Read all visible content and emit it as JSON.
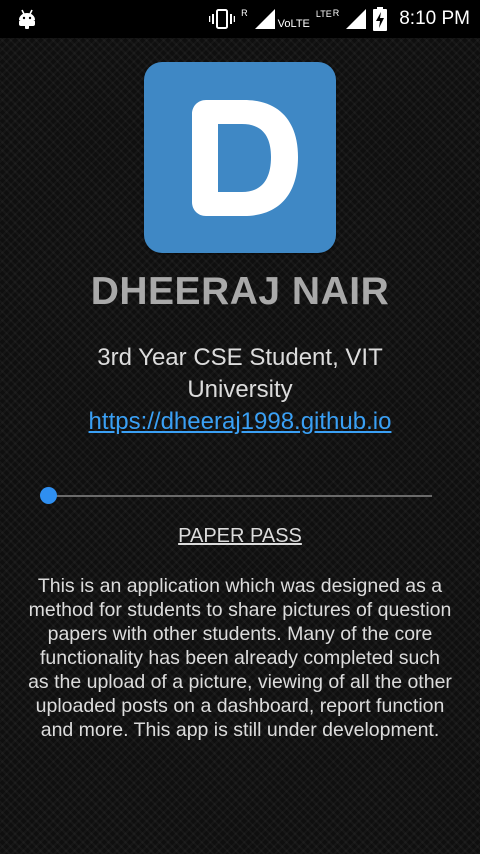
{
  "status_bar": {
    "roaming_label": "R",
    "volte_label": "VoLTE",
    "lte_label": "LTE",
    "roaming_label_2": "R",
    "time": "8:10 PM",
    "icons": [
      "android-notification-icon",
      "vibrate-icon",
      "signal-icon",
      "signal-icon",
      "battery-charging-icon"
    ]
  },
  "app": {
    "logo_letter": "D",
    "logo_color": "#3f88c5",
    "name": "DHEERAJ NAIR",
    "subtitle": "3rd Year CSE Student, VIT University",
    "link": "https://dheeraj1998.github.io",
    "link_color": "#3aa0f5",
    "slider_value_percent": 0,
    "section_title": "PAPER PASS",
    "description": "This is an application which was designed as a method for students to share pictures of question papers with other students. Many of the core functionality has been already completed such as the upload of a picture, viewing of all the other uploaded posts on a dashboard, report function and more. This app is still under development."
  }
}
